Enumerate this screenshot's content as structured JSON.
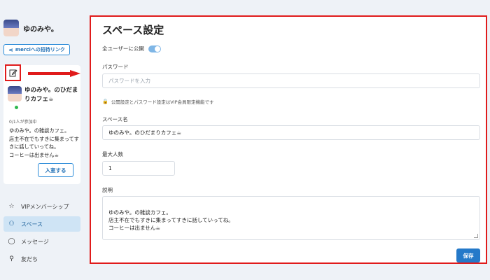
{
  "user": {
    "name": "ゆのみや。"
  },
  "sidebar": {
    "invite_label": "merciへの招待リンク",
    "space_card": {
      "title": "ゆのみや。のひだまりカフェ☕",
      "count": "0/1人が参加中",
      "description": "ゆのみや。の雑談カフェ。\n店主不在でもすきに集まってすきに話していってね。\nコーヒーは出ません☕",
      "enter_label": "入室する"
    },
    "nav": [
      {
        "label": "VIPメンバーシップ",
        "icon": "star-icon"
      },
      {
        "label": "スペース",
        "icon": "people-icon"
      },
      {
        "label": "メッセージ",
        "icon": "chat-icon"
      },
      {
        "label": "友だち",
        "icon": "add-friend-icon"
      }
    ]
  },
  "main": {
    "title": "スペース設定",
    "public_label": "全ユーザーに公開",
    "password_label": "パスワード",
    "password_placeholder": "パスワードを入力",
    "vip_note": "公開設定とパスワード設定はVIP会員限定機能です",
    "space_name_label": "スペース名",
    "space_name_value": "ゆのみや。のひだまりカフェ☕",
    "max_people_label": "最大人数",
    "max_people_value": "1",
    "description_label": "説明",
    "description_value": "ゆのみや。の雑談カフェ。\n店主不在でもすきに集まってすきに話していってね。\nコーヒーは出ません☕",
    "save_label": "保存"
  },
  "colors": {
    "accent": "#2479c9",
    "highlight_border": "#e01b1b",
    "active_nav_bg": "#cfe4f5"
  }
}
